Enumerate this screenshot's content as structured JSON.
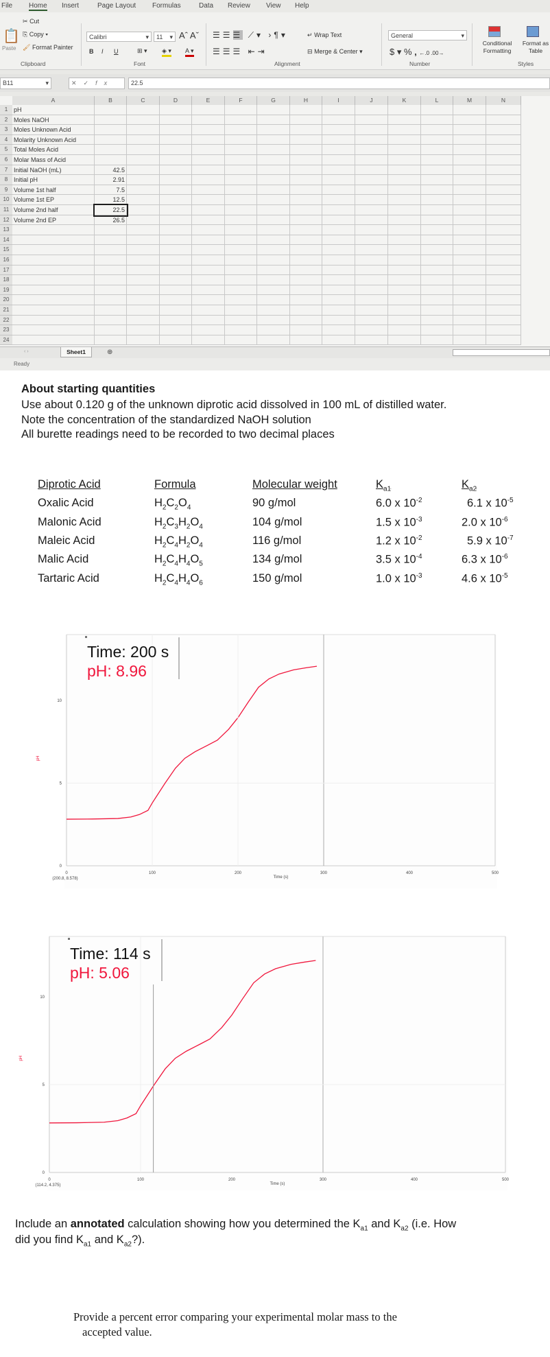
{
  "excel": {
    "menu": [
      "File",
      "Home",
      "Insert",
      "Page Layout",
      "Formulas",
      "Data",
      "Review",
      "View",
      "Help"
    ],
    "active_menu": "Home",
    "clipboard": {
      "paste": "Paste",
      "cut": "Cut",
      "copy": "Copy",
      "format_painter": "Format Painter",
      "label": "Clipboard"
    },
    "font": {
      "name": "Calibri",
      "size": "11",
      "bold": "B",
      "italic": "I",
      "underline": "U",
      "label": "Font"
    },
    "alignment": {
      "wrap_text": "Wrap Text",
      "merge_center": "Merge & Center",
      "label": "Alignment"
    },
    "number": {
      "format": "General",
      "currency": "$",
      "percent": "%",
      "comma": ",",
      "label": "Number"
    },
    "styles": {
      "conditional": "Conditional Formatting",
      "format_table": "Format as Table",
      "label": "Styles"
    },
    "name_box": "B11",
    "formula_value": "22.5",
    "columns": [
      "A",
      "B",
      "C",
      "D",
      "E",
      "F",
      "G",
      "H",
      "I",
      "J",
      "K",
      "L",
      "M",
      "N"
    ],
    "rows": [
      {
        "n": "1",
        "a": "pH",
        "b": ""
      },
      {
        "n": "2",
        "a": "Moles NaOH",
        "b": ""
      },
      {
        "n": "3",
        "a": "Moles Unknown Acid",
        "b": ""
      },
      {
        "n": "4",
        "a": "Molarity Unknown Acid",
        "b": ""
      },
      {
        "n": "5",
        "a": "Total Moles Acid",
        "b": ""
      },
      {
        "n": "6",
        "a": "Molar Mass of Acid",
        "b": ""
      },
      {
        "n": "7",
        "a": "Initial NaOH (mL)",
        "b": "42.5"
      },
      {
        "n": "8",
        "a": "Initial pH",
        "b": "2.91"
      },
      {
        "n": "9",
        "a": "Volume 1st half",
        "b": "7.5"
      },
      {
        "n": "10",
        "a": "Volume 1st EP",
        "b": "12.5"
      },
      {
        "n": "11",
        "a": "Volume 2nd half",
        "b": "22.5"
      },
      {
        "n": "12",
        "a": "Volume 2nd EP",
        "b": "26.5"
      },
      {
        "n": "13"
      },
      {
        "n": "14"
      },
      {
        "n": "15"
      },
      {
        "n": "16"
      },
      {
        "n": "17"
      },
      {
        "n": "18"
      },
      {
        "n": "19"
      },
      {
        "n": "20"
      },
      {
        "n": "21"
      },
      {
        "n": "22"
      },
      {
        "n": "23"
      },
      {
        "n": "24"
      }
    ],
    "selected_row": "11",
    "sheet_tab": "Sheet1",
    "status": "Ready"
  },
  "instructions": {
    "heading": "About starting quantities",
    "lines": [
      "Use about 0.120 g of the unknown diprotic acid dissolved in 100 mL of distilled water.",
      "Note the concentration of the standardized NaOH solution",
      "All burette readings need to be recorded to two decimal places"
    ]
  },
  "acid_table": {
    "headers": [
      "Diprotic Acid",
      "Formula",
      "Molecular weight",
      "Ka1",
      "Ka2"
    ],
    "rows": [
      {
        "name": "Oxalic Acid",
        "formula": "H2C2O4",
        "mw": "90 g/mol",
        "ka1": "6.0 x 10-2",
        "ka2": "6.1 x 10-5"
      },
      {
        "name": "Malonic Acid",
        "formula": "H2C3H2O4",
        "mw": "104 g/mol",
        "ka1": "1.5 x 10-3",
        "ka2": "2.0 x 10-6"
      },
      {
        "name": "Maleic Acid",
        "formula": "H2C4H2O4",
        "mw": "116 g/mol",
        "ka1": "1.2 x 10-2",
        "ka2": "5.9 x 10-7"
      },
      {
        "name": "Malic Acid",
        "formula": "H2C4H4O5",
        "mw": "134 g/mol",
        "ka1": "3.5 x 10-4",
        "ka2": "6.3 x 10-6"
      },
      {
        "name": "Tartaric Acid",
        "formula": "H2C4H4O6",
        "mw": "150 g/mol",
        "ka1": "1.0 x 10-3",
        "ka2": "4.6 x 10-5"
      }
    ]
  },
  "chart_data": [
    {
      "type": "line",
      "xlabel": "Time (s)",
      "ylabel": "pH",
      "xlim": [
        0,
        500
      ],
      "ylim": [
        0,
        12.5
      ],
      "xticks": [
        "0",
        "100",
        "200",
        "300",
        "400",
        "500"
      ],
      "yticks": [
        "0",
        "5",
        "10"
      ],
      "line_color": "#f0163c",
      "tooltip": {
        "time": "Time: 200 s",
        "ph": "pH: 8.96"
      },
      "cursor_time": 200,
      "coordinate_readout": "(200.8, 8.578)",
      "series": [
        {
          "x": [
            0,
            30,
            60,
            75,
            85,
            95,
            100,
            105,
            115,
            127,
            138,
            150,
            165,
            176,
            189,
            200,
            212,
            224,
            236,
            248,
            265,
            280,
            292
          ],
          "y": [
            2.82,
            2.83,
            2.86,
            2.95,
            3.1,
            3.35,
            3.8,
            4.2,
            5.0,
            5.9,
            6.5,
            6.9,
            7.3,
            7.6,
            8.25,
            8.96,
            9.9,
            10.8,
            11.3,
            11.6,
            11.85,
            11.98,
            12.07
          ]
        }
      ]
    },
    {
      "type": "line",
      "xlabel": "Time (s)",
      "ylabel": "pH",
      "xlim": [
        0,
        500
      ],
      "ylim": [
        0,
        12.5
      ],
      "xticks": [
        "0",
        "100",
        "200",
        "300",
        "400",
        "500"
      ],
      "yticks": [
        "0",
        "5",
        "10"
      ],
      "line_color": "#f0163c",
      "tooltip": {
        "time": "Time: 114 s",
        "ph": "pH: 5.06"
      },
      "cursor_time": 114,
      "coordinate_readout": "(114.2, 4.375)",
      "series": [
        {
          "x": [
            0,
            30,
            60,
            75,
            85,
            95,
            100,
            105,
            115,
            127,
            138,
            150,
            165,
            176,
            189,
            200,
            212,
            224,
            236,
            248,
            265,
            280,
            292
          ],
          "y": [
            2.82,
            2.83,
            2.86,
            2.95,
            3.1,
            3.35,
            3.8,
            4.2,
            5.0,
            5.9,
            6.5,
            6.9,
            7.3,
            7.6,
            8.25,
            8.96,
            9.9,
            10.8,
            11.3,
            11.6,
            11.85,
            11.98,
            12.07
          ]
        }
      ]
    }
  ],
  "questions": {
    "q1_pre": "Include an ",
    "q1_bold": "annotated",
    "q1_post": " calculation showing how you determined the Ka1 and Ka2 (i.e. How",
    "q1_line2": "did you find Ka1 and Ka2?).",
    "q2_line1": "Provide a percent error comparing your experimental molar mass to the",
    "q2_line2": "accepted value."
  }
}
